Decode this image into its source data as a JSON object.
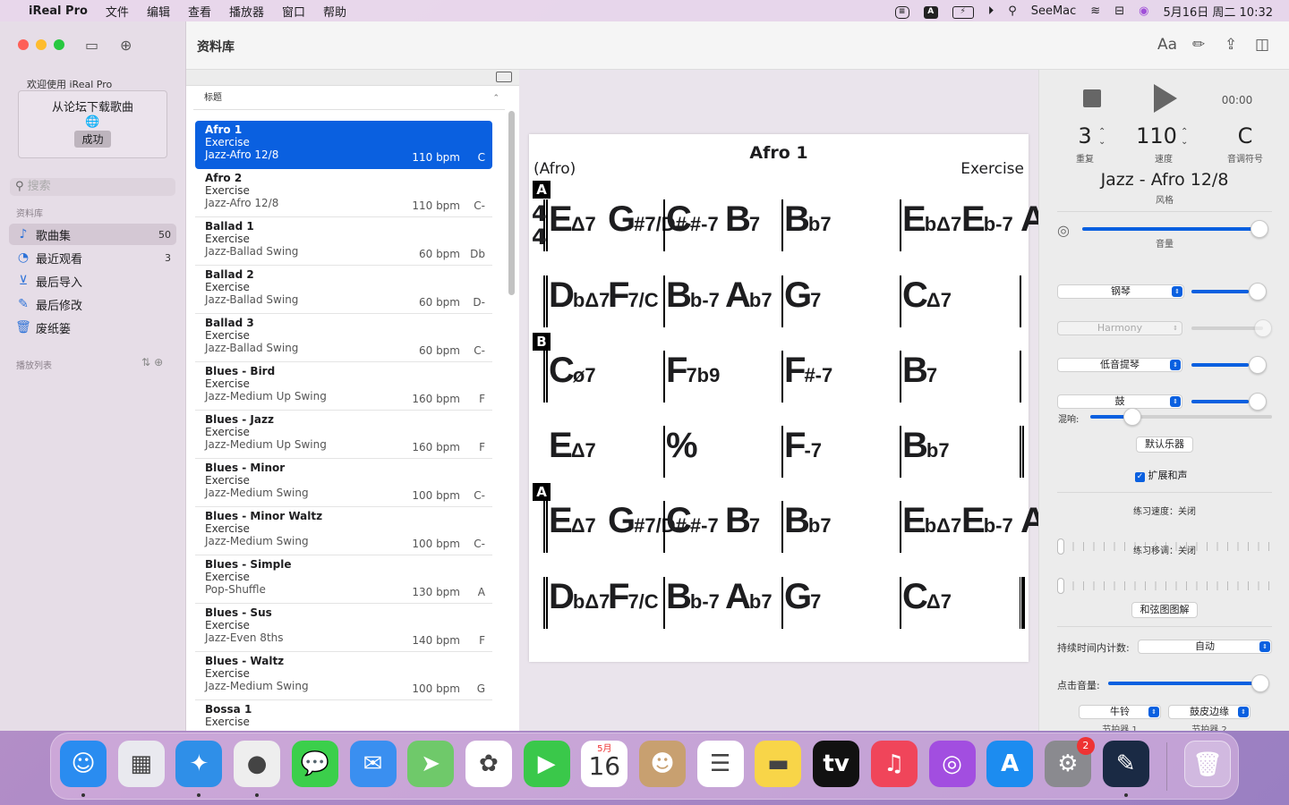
{
  "menubar": {
    "apple": "",
    "app": "iReal Pro",
    "menus": [
      "文件",
      "编辑",
      "查看",
      "播放器",
      "窗口",
      "帮助"
    ],
    "status_a": "A",
    "username": "SeeMac",
    "datetime": "5月16日 周二  10:32"
  },
  "sidebar": {
    "welcome": "欢迎使用 iReal Pro",
    "download_title": "从论坛下载歌曲",
    "download_globe": "🌐",
    "download_status": "成功",
    "search_placeholder": "搜索",
    "section_library": "资料库",
    "items": [
      {
        "label": "歌曲集",
        "count": "50",
        "icon": "music-note-icon"
      },
      {
        "label": "最近观看",
        "count": "3",
        "icon": "clock-icon"
      },
      {
        "label": "最后导入",
        "count": "",
        "icon": "download-icon"
      },
      {
        "label": "最后修改",
        "count": "",
        "icon": "edit-icon"
      },
      {
        "label": "废纸篓",
        "count": "",
        "icon": "trash-icon"
      }
    ],
    "section_playlists": "播放列表"
  },
  "header": {
    "title": "资料库",
    "font_button": "Aa"
  },
  "list": {
    "column_title": "标题",
    "songs": [
      {
        "name": "Afro 1",
        "composer": "Exercise",
        "style": "Jazz-Afro 12/8",
        "bpm": "110 bpm",
        "key": "C"
      },
      {
        "name": "Afro 2",
        "composer": "Exercise",
        "style": "Jazz-Afro 12/8",
        "bpm": "110 bpm",
        "key": "C-"
      },
      {
        "name": "Ballad 1",
        "composer": "Exercise",
        "style": "Jazz-Ballad Swing",
        "bpm": "60 bpm",
        "key": "Db"
      },
      {
        "name": "Ballad 2",
        "composer": "Exercise",
        "style": "Jazz-Ballad Swing",
        "bpm": "60 bpm",
        "key": "D-"
      },
      {
        "name": "Ballad 3",
        "composer": "Exercise",
        "style": "Jazz-Ballad Swing",
        "bpm": "60 bpm",
        "key": "C-"
      },
      {
        "name": "Blues - Bird",
        "composer": "Exercise",
        "style": "Jazz-Medium Up Swing",
        "bpm": "160 bpm",
        "key": "F"
      },
      {
        "name": "Blues - Jazz",
        "composer": "Exercise",
        "style": "Jazz-Medium Up Swing",
        "bpm": "160 bpm",
        "key": "F"
      },
      {
        "name": "Blues - Minor",
        "composer": "Exercise",
        "style": "Jazz-Medium Swing",
        "bpm": "100 bpm",
        "key": "C-"
      },
      {
        "name": "Blues - Minor Waltz",
        "composer": "Exercise",
        "style": "Jazz-Medium Swing",
        "bpm": "100 bpm",
        "key": "C-"
      },
      {
        "name": "Blues - Simple",
        "composer": "Exercise",
        "style": "Pop-Shuffle",
        "bpm": "130 bpm",
        "key": "A"
      },
      {
        "name": "Blues - Sus",
        "composer": "Exercise",
        "style": "Jazz-Even 8ths",
        "bpm": "140 bpm",
        "key": "F"
      },
      {
        "name": "Blues - Waltz",
        "composer": "Exercise",
        "style": "Jazz-Medium Swing",
        "bpm": "100 bpm",
        "key": "G"
      },
      {
        "name": "Bossa 1",
        "composer": "Exercise",
        "style": "",
        "bpm": "",
        "key": ""
      }
    ]
  },
  "chart": {
    "title": "Afro 1",
    "style": "(Afro)",
    "composer": "Exercise",
    "time_signature": [
      "4",
      "4"
    ],
    "rehearsal_marks": [
      "A",
      "B",
      "A"
    ],
    "chords": [
      {
        "root": "E",
        "q": "Δ7"
      },
      {
        "root": "G",
        "q": "#7/D#"
      },
      {
        "root": "C",
        "q": "#-7"
      },
      {
        "root": "B",
        "q": "7"
      },
      {
        "root": "B",
        "q": "b7"
      },
      {
        "root": "E",
        "q": "bΔ7"
      },
      {
        "root": "E",
        "q": "b-7"
      },
      {
        "root": "A",
        "q": "b7"
      },
      {
        "root": "D",
        "q": "bΔ7"
      },
      {
        "root": "F",
        "q": "7/C"
      },
      {
        "root": "B",
        "q": "b-7"
      },
      {
        "root": "A",
        "q": "b7"
      },
      {
        "root": "G",
        "q": "7"
      },
      {
        "root": "C",
        "q": "Δ7"
      },
      {
        "root": "C",
        "q": "ø7"
      },
      {
        "root": "F",
        "q": "7b9"
      },
      {
        "root": "F",
        "q": "#-7"
      },
      {
        "root": "B",
        "q": "7"
      },
      {
        "root": "E",
        "q": "Δ7"
      },
      {
        "root": "%",
        "q": ""
      },
      {
        "root": "F",
        "q": "-7"
      },
      {
        "root": "B",
        "q": "b7"
      },
      {
        "root": "E",
        "q": "Δ7"
      },
      {
        "root": "G",
        "q": "#7/D#"
      },
      {
        "root": "C",
        "q": "#-7"
      },
      {
        "root": "B",
        "q": "7"
      },
      {
        "root": "B",
        "q": "b7"
      },
      {
        "root": "E",
        "q": "bΔ7"
      },
      {
        "root": "E",
        "q": "b-7"
      },
      {
        "root": "A",
        "q": "b7"
      },
      {
        "root": "D",
        "q": "bΔ7"
      },
      {
        "root": "F",
        "q": "7/C"
      },
      {
        "root": "B",
        "q": "b-7"
      },
      {
        "root": "A",
        "q": "b7"
      },
      {
        "root": "G",
        "q": "7"
      },
      {
        "root": "C",
        "q": "Δ7"
      }
    ]
  },
  "player": {
    "time": "00:00",
    "repeat_value": "3",
    "repeat_label": "重复",
    "tempo_value": "110",
    "tempo_label": "速度",
    "key_value": "C",
    "key_label": "音调符号",
    "style_value": "Jazz - Afro 12/8",
    "style_label": "风格",
    "volume_label": "音量",
    "volume_level": 0.98,
    "instruments": [
      {
        "name": "钢琴",
        "level": 0.8,
        "disabled": false
      },
      {
        "name": "Harmony",
        "level": 0.0,
        "disabled": true
      },
      {
        "name": "低音提琴",
        "level": 0.8,
        "disabled": false
      },
      {
        "name": "鼓",
        "level": 0.8,
        "disabled": false
      }
    ],
    "reverb_label": "混响:",
    "reverb_level": 0.23,
    "default_instruments": "默认乐器",
    "extended_harmony": "扩展和声",
    "practice_tempo": "练习速度：关闭",
    "practice_transpose": "练习移调：关闭",
    "chord_diagrams": "和弦图图解",
    "count_in_label": "持续时间内计数:",
    "count_in_value": "自动",
    "click_volume_label": "点击音量:",
    "click_volume_level": 0.98,
    "metronome1_value": "牛铃",
    "metronome1_label": "节拍器 1",
    "metronome2_value": "鼓皮边缘",
    "metronome2_label": "节拍器 2"
  },
  "dock": {
    "apps": [
      {
        "name": "finder",
        "glyph": "☺",
        "color": "#2a8cf0"
      },
      {
        "name": "launchpad",
        "glyph": "▦",
        "color": "#e9e9ef"
      },
      {
        "name": "safari",
        "glyph": "✦",
        "color": "#2f8fe8"
      },
      {
        "name": "chrome",
        "glyph": "●",
        "color": "#eeeeee"
      },
      {
        "name": "messages",
        "glyph": "💬",
        "color": "#3bcf4b"
      },
      {
        "name": "mail",
        "glyph": "✉",
        "color": "#3a8ff0"
      },
      {
        "name": "maps",
        "glyph": "➤",
        "color": "#6fc96a"
      },
      {
        "name": "photos",
        "glyph": "✿",
        "color": "#ffffff"
      },
      {
        "name": "facetime",
        "glyph": "▶",
        "color": "#3ac84a"
      },
      {
        "name": "calendar",
        "glyph": "16",
        "color": "#ffffff"
      },
      {
        "name": "contacts",
        "glyph": "☻",
        "color": "#c8a070"
      },
      {
        "name": "reminders",
        "glyph": "☰",
        "color": "#ffffff"
      },
      {
        "name": "notes",
        "glyph": "▬",
        "color": "#f8d548"
      },
      {
        "name": "apple-tv",
        "glyph": "tv",
        "color": "#111111"
      },
      {
        "name": "music",
        "glyph": "♫",
        "color": "#f0455a"
      },
      {
        "name": "podcasts",
        "glyph": "◎",
        "color": "#a24ee0"
      },
      {
        "name": "app-store",
        "glyph": "A",
        "color": "#1c8cf0"
      },
      {
        "name": "system-preferences",
        "glyph": "⚙",
        "color": "#8a8a8f"
      },
      {
        "name": "ireal-pro",
        "glyph": "✎",
        "color": "#1a2a44"
      }
    ],
    "calendar_month": "5月",
    "calendar_day": "16",
    "settings_badge": "2"
  }
}
